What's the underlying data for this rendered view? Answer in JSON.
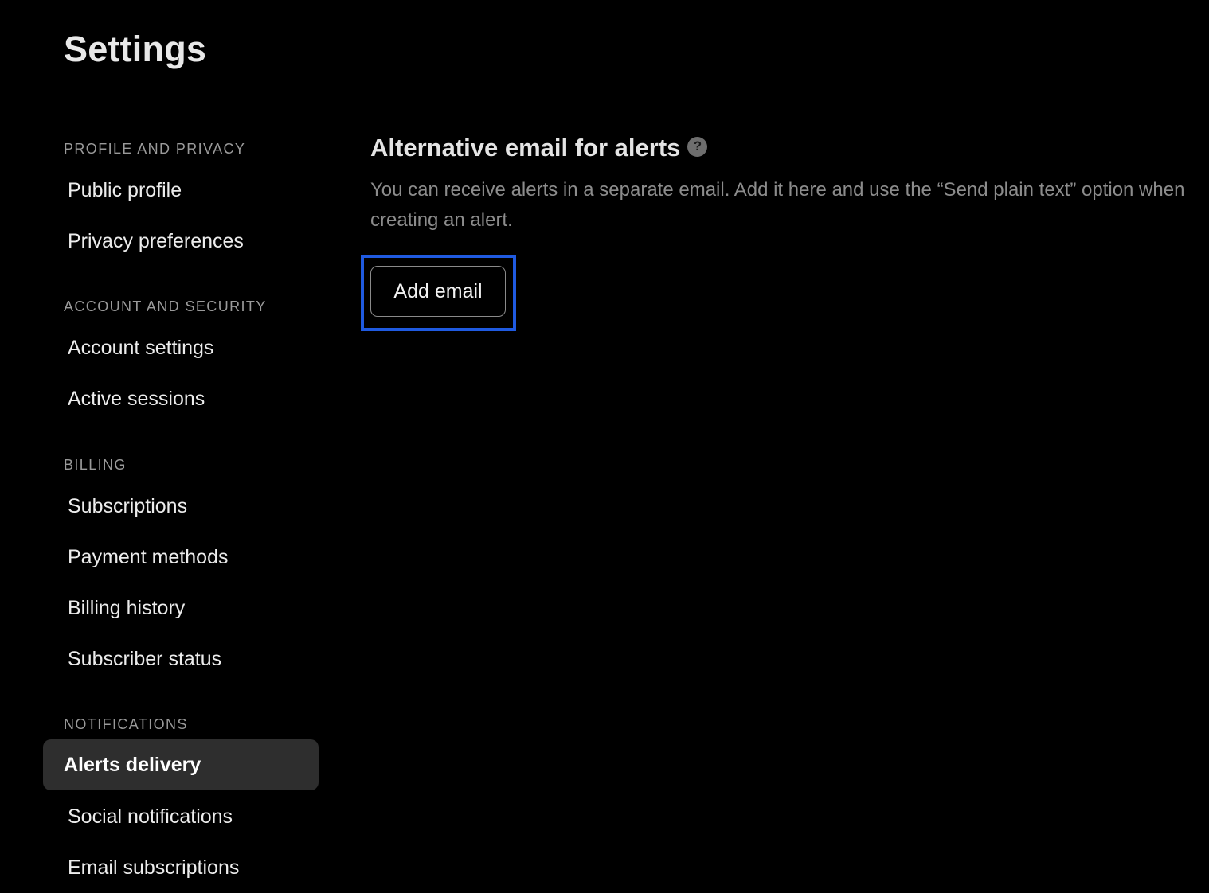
{
  "page": {
    "title": "Settings"
  },
  "sidebar": {
    "sections": [
      {
        "header": "PROFILE AND PRIVACY",
        "items": [
          {
            "label": "Public profile"
          },
          {
            "label": "Privacy preferences"
          }
        ]
      },
      {
        "header": "ACCOUNT AND SECURITY",
        "items": [
          {
            "label": "Account settings"
          },
          {
            "label": "Active sessions"
          }
        ]
      },
      {
        "header": "BILLING",
        "items": [
          {
            "label": "Subscriptions"
          },
          {
            "label": "Payment methods"
          },
          {
            "label": "Billing history"
          },
          {
            "label": "Subscriber status"
          }
        ]
      },
      {
        "header": "NOTIFICATIONS",
        "items": [
          {
            "label": "Alerts delivery",
            "active": true
          },
          {
            "label": "Social notifications"
          },
          {
            "label": "Email subscriptions"
          }
        ]
      }
    ]
  },
  "main": {
    "section_title": "Alternative email for alerts",
    "help_icon": "question-mark-circle-icon",
    "help_glyph": "?",
    "description": "You can receive alerts in a separate email. Add it here and use the “Send plain text” option when creating an alert.",
    "add_email_label": "Add email"
  },
  "colors": {
    "background": "#000000",
    "active_item_bg": "#2e2e2e",
    "focus_ring": "#1f5ae0",
    "muted_text": "#8c8c8c"
  }
}
